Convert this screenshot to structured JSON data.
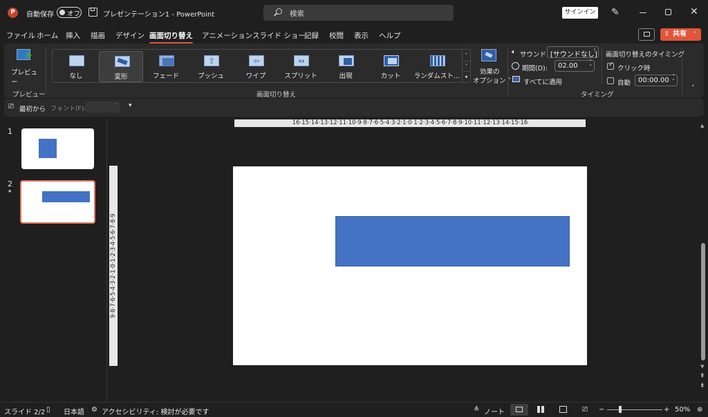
{
  "titlebar": {
    "autosave_label": "自動保存",
    "autosave_state": "オフ",
    "doc_title": "プレゼンテーション1 - PowerPoint",
    "search_placeholder": "検索",
    "signin_label": "サインイン"
  },
  "tabs": [
    "ファイル",
    "ホーム",
    "挿入",
    "描画",
    "デザイン",
    "画面切り替え",
    "アニメーション",
    "スライド ショー",
    "記録",
    "校閲",
    "表示",
    "ヘルプ"
  ],
  "active_tab": "画面切り替え",
  "share_label": "共有",
  "ribbon": {
    "preview_label": "プレビュー",
    "preview_group": "プレビュー",
    "gallery": [
      {
        "label": "なし",
        "icon": "transition-none-icon"
      },
      {
        "label": "変形",
        "icon": "transition-morph-icon"
      },
      {
        "label": "フェード",
        "icon": "transition-fade-icon"
      },
      {
        "label": "プッシュ",
        "icon": "transition-push-icon"
      },
      {
        "label": "ワイプ",
        "icon": "transition-wipe-icon"
      },
      {
        "label": "スプリット",
        "icon": "transition-split-icon"
      },
      {
        "label": "出現",
        "icon": "transition-reveal-icon"
      },
      {
        "label": "カット",
        "icon": "transition-cut-icon"
      },
      {
        "label": "ランダムスト…",
        "icon": "transition-random-bars-icon"
      }
    ],
    "selected_transition": "変形",
    "effect_options_line1": "効果の",
    "effect_options_line2": "オプション ˅",
    "transition_group": "画面切り替え",
    "sound_label": "サウンド:",
    "sound_value": "[サウンドなし]",
    "duration_label": "期間(D):",
    "duration_value": "02.00",
    "apply_all_label": "すべてに適用",
    "timing_header": "画面切り替えのタイミング",
    "on_click_label": "クリック時",
    "on_click_checked": true,
    "auto_label": "自動",
    "auto_checked": false,
    "auto_time": "00:00.00",
    "timing_group": "タイミング"
  },
  "qat": {
    "from_start": "最初から",
    "font_label": "フォント(F):"
  },
  "slides": [
    {
      "number": "1",
      "star": ""
    },
    {
      "number": "2",
      "star": "★"
    }
  ],
  "selected_slide": 2,
  "hruler_text": "16·15·14·13·12·11·10·9·8·7·6·5·4·3·2·1·0·1·2·3·4·5·6·7·8·9·10·11·12·13·14·15·16",
  "vruler_text": "9·8·7·6·5·4·3·2·1·0·1·2·3·4·5·6·7·8·9",
  "status": {
    "slide_info": "スライド 2/2",
    "language": "日本語",
    "accessibility": "アクセシビリティ: 検討が必要です",
    "notes": "ノート",
    "zoom": "50%"
  },
  "colors": {
    "accent": "#e0563b",
    "shape_fill": "#4472c4",
    "background": "#1f1f1f",
    "ribbon": "#2b2b2b"
  }
}
